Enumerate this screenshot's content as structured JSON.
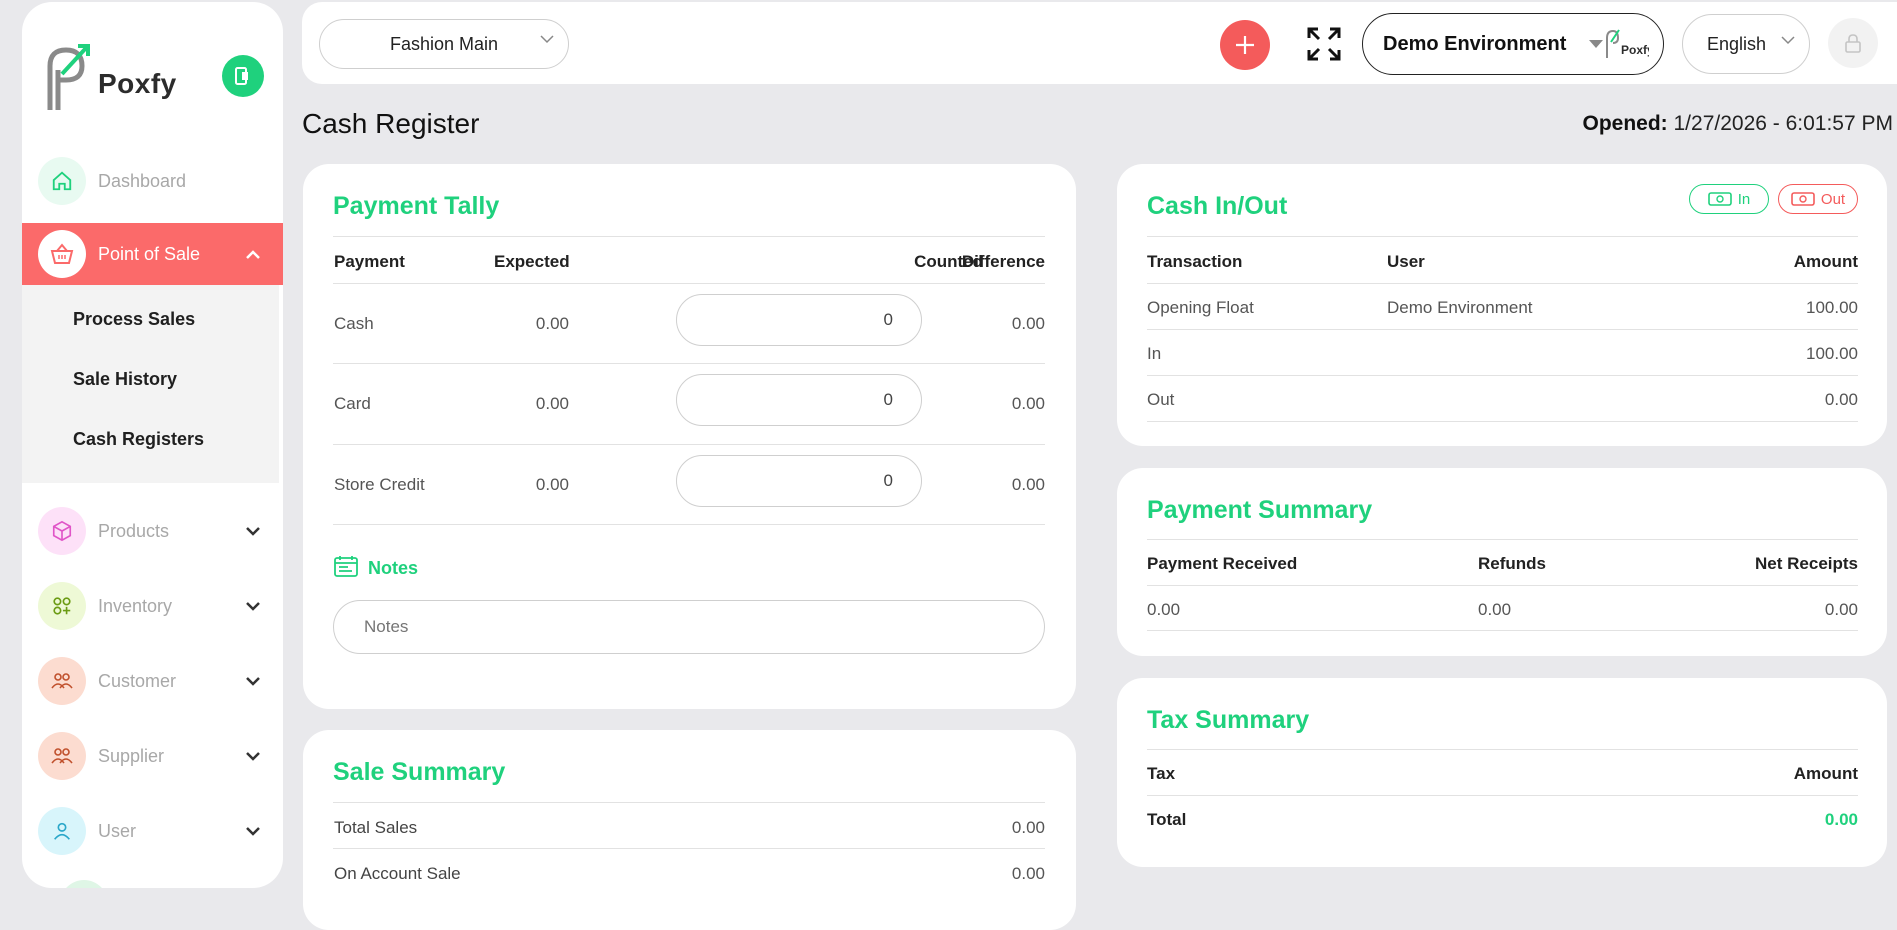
{
  "brand": {
    "name": "Poxfy"
  },
  "sidebar": {
    "items": [
      {
        "label": "Dashboard",
        "icon": "home-icon"
      },
      {
        "label": "Point of Sale",
        "icon": "basket-icon",
        "active": true
      },
      {
        "label": "Products",
        "icon": "box-icon"
      },
      {
        "label": "Inventory",
        "icon": "grid-plus-icon"
      },
      {
        "label": "Customer",
        "icon": "users-icon"
      },
      {
        "label": "Supplier",
        "icon": "users-icon"
      },
      {
        "label": "User",
        "icon": "user-icon"
      }
    ],
    "submenu": [
      "Process Sales",
      "Sale History",
      "Cash Registers"
    ]
  },
  "topbar": {
    "store": "Fashion Main",
    "environment": "Demo Environment",
    "language": "English"
  },
  "page": {
    "title": "Cash Register",
    "opened_label": "Opened:",
    "opened_value": "1/27/2026 - 6:01:57 PM"
  },
  "payment_tally": {
    "title": "Payment Tally",
    "headers": [
      "Payment",
      "Expected",
      "Counted",
      "Difference"
    ],
    "rows": [
      {
        "payment": "Cash",
        "expected": "0.00",
        "counted": "0",
        "difference": "0.00"
      },
      {
        "payment": "Card",
        "expected": "0.00",
        "counted": "0",
        "difference": "0.00"
      },
      {
        "payment": "Store Credit",
        "expected": "0.00",
        "counted": "0",
        "difference": "0.00"
      }
    ],
    "notes_label": "Notes",
    "notes_placeholder": "Notes"
  },
  "sale_summary": {
    "title": "Sale Summary",
    "rows": [
      {
        "label": "Total Sales",
        "value": "0.00"
      },
      {
        "label": "On Account Sale",
        "value": "0.00"
      }
    ]
  },
  "cash_inout": {
    "title": "Cash In/Out",
    "in_label": "In",
    "out_label": "Out",
    "headers": [
      "Transaction",
      "User",
      "Amount"
    ],
    "rows": [
      {
        "transaction": "Opening Float",
        "user": "Demo Environment",
        "amount": "100.00"
      },
      {
        "transaction": "In",
        "user": "",
        "amount": "100.00"
      },
      {
        "transaction": "Out",
        "user": "",
        "amount": "0.00"
      }
    ]
  },
  "payment_summary": {
    "title": "Payment Summary",
    "headers": [
      "Payment Received",
      "Refunds",
      "Net Receipts"
    ],
    "row": {
      "received": "0.00",
      "refunds": "0.00",
      "net": "0.00"
    }
  },
  "tax_summary": {
    "title": "Tax Summary",
    "headers": [
      "Tax",
      "Amount"
    ],
    "total_label": "Total",
    "total_value": "0.00"
  },
  "colors": {
    "accent": "#1fd17d",
    "active": "#fb6a6a",
    "danger": "#f45b5b"
  }
}
